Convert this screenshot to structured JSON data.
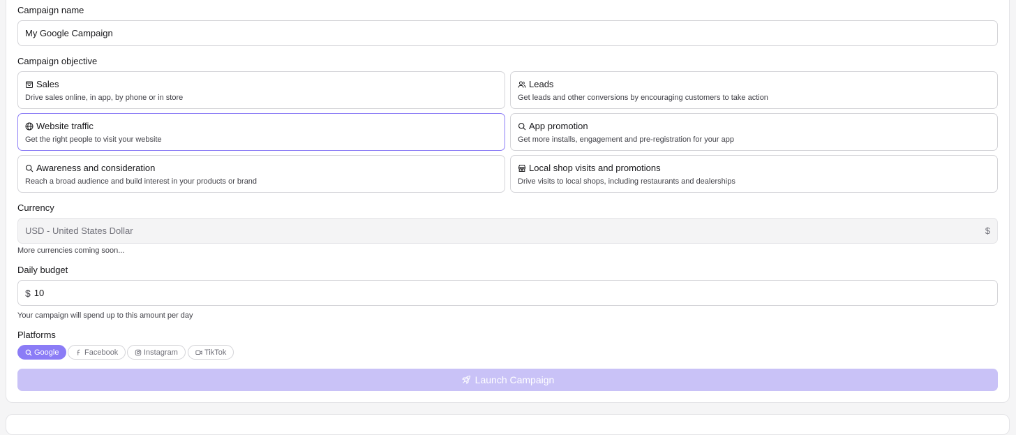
{
  "campaign_name": {
    "label": "Campaign name",
    "value": "My Google Campaign"
  },
  "objective": {
    "label": "Campaign objective",
    "options": [
      {
        "title": "Sales",
        "description": "Drive sales online, in app, by phone or in store",
        "icon": "shopping-bag-icon",
        "selected": false
      },
      {
        "title": "Leads",
        "description": "Get leads and other conversions by encouraging customers to take action",
        "icon": "users-icon",
        "selected": false
      },
      {
        "title": "Website traffic",
        "description": "Get the right people to visit your website",
        "icon": "globe-icon",
        "selected": true
      },
      {
        "title": "App promotion",
        "description": "Get more installs, engagement and pre-registration for your app",
        "icon": "search-icon",
        "selected": false
      },
      {
        "title": "Awareness and consideration",
        "description": "Reach a broad audience and build interest in your products or brand",
        "icon": "search-icon",
        "selected": false
      },
      {
        "title": "Local shop visits and promotions",
        "description": "Drive visits to local shops, including restaurants and dealerships",
        "icon": "store-icon",
        "selected": false
      }
    ]
  },
  "currency": {
    "label": "Currency",
    "value": "USD - United States Dollar",
    "symbol": "$",
    "help": "More currencies coming soon..."
  },
  "budget": {
    "label": "Daily budget",
    "prefix": "$",
    "value": "10",
    "help": "Your campaign will spend up to this amount per day"
  },
  "platforms": {
    "label": "Platforms",
    "items": [
      {
        "label": "Google",
        "icon": "search-icon",
        "active": true
      },
      {
        "label": "Facebook",
        "icon": "facebook-icon",
        "active": false
      },
      {
        "label": "Instagram",
        "icon": "instagram-icon",
        "active": false
      },
      {
        "label": "TikTok",
        "icon": "video-icon",
        "active": false
      }
    ]
  },
  "launch_button": {
    "label": "Launch Campaign",
    "icon": "rocket-icon"
  },
  "colors": {
    "accent": "#8b7cf6",
    "button_disabled": "#c9c2f7"
  }
}
